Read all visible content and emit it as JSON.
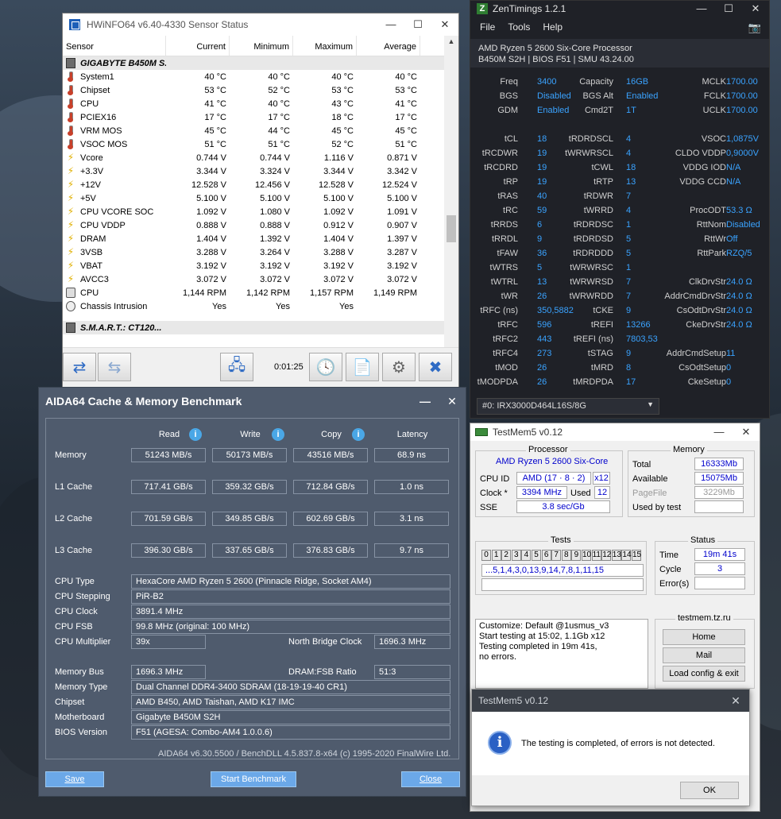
{
  "hwinfo": {
    "title": "HWiNFO64 v6.40-4330 Sensor Status",
    "columns": [
      "Sensor",
      "Current",
      "Minimum",
      "Maximum",
      "Average"
    ],
    "group1": "GIGABYTE B450M S...",
    "rows": [
      {
        "icon": "temp",
        "name": "System1",
        "cur": "40 °C",
        "min": "40 °C",
        "max": "40 °C",
        "avg": "40 °C"
      },
      {
        "icon": "temp",
        "name": "Chipset",
        "cur": "53 °C",
        "min": "52 °C",
        "max": "53 °C",
        "avg": "53 °C"
      },
      {
        "icon": "temp",
        "name": "CPU",
        "cur": "41 °C",
        "min": "40 °C",
        "max": "43 °C",
        "avg": "41 °C"
      },
      {
        "icon": "temp",
        "name": "PCIEX16",
        "cur": "17 °C",
        "min": "17 °C",
        "max": "18 °C",
        "avg": "17 °C"
      },
      {
        "icon": "temp",
        "name": "VRM MOS",
        "cur": "45 °C",
        "min": "44 °C",
        "max": "45 °C",
        "avg": "45 °C"
      },
      {
        "icon": "temp",
        "name": "VSOC MOS",
        "cur": "51 °C",
        "min": "51 °C",
        "max": "52 °C",
        "avg": "51 °C"
      },
      {
        "icon": "volt",
        "name": "Vcore",
        "cur": "0.744 V",
        "min": "0.744 V",
        "max": "1.116 V",
        "avg": "0.871 V"
      },
      {
        "icon": "volt",
        "name": "+3.3V",
        "cur": "3.344 V",
        "min": "3.324 V",
        "max": "3.344 V",
        "avg": "3.342 V"
      },
      {
        "icon": "volt",
        "name": "+12V",
        "cur": "12.528 V",
        "min": "12.456 V",
        "max": "12.528 V",
        "avg": "12.524 V"
      },
      {
        "icon": "volt",
        "name": "+5V",
        "cur": "5.100 V",
        "min": "5.100 V",
        "max": "5.100 V",
        "avg": "5.100 V"
      },
      {
        "icon": "volt",
        "name": "CPU VCORE SOC",
        "cur": "1.092 V",
        "min": "1.080 V",
        "max": "1.092 V",
        "avg": "1.091 V"
      },
      {
        "icon": "volt",
        "name": "CPU VDDP",
        "cur": "0.888 V",
        "min": "0.888 V",
        "max": "0.912 V",
        "avg": "0.907 V"
      },
      {
        "icon": "volt",
        "name": "DRAM",
        "cur": "1.404 V",
        "min": "1.392 V",
        "max": "1.404 V",
        "avg": "1.397 V"
      },
      {
        "icon": "volt",
        "name": "3VSB",
        "cur": "3.288 V",
        "min": "3.264 V",
        "max": "3.288 V",
        "avg": "3.287 V"
      },
      {
        "icon": "volt",
        "name": "VBAT",
        "cur": "3.192 V",
        "min": "3.192 V",
        "max": "3.192 V",
        "avg": "3.192 V"
      },
      {
        "icon": "volt",
        "name": "AVCC3",
        "cur": "3.072 V",
        "min": "3.072 V",
        "max": "3.072 V",
        "avg": "3.072 V"
      },
      {
        "icon": "fan",
        "name": "CPU",
        "cur": "1,144 RPM",
        "min": "1,142 RPM",
        "max": "1,157 RPM",
        "avg": "1,149 RPM"
      },
      {
        "icon": "intr",
        "name": "Chassis Intrusion",
        "cur": "Yes",
        "min": "Yes",
        "max": "Yes",
        "avg": ""
      }
    ],
    "group2": "S.M.A.R.T.: CT120...",
    "timer": "0:01:25"
  },
  "zen": {
    "title": "ZenTimings 1.2.1",
    "menu": [
      "File",
      "Tools",
      "Help"
    ],
    "cpu": "AMD Ryzen 5 2600 Six-Core Processor",
    "board": "B450M S2H | BIOS F51 | SMU 43.24.00",
    "top": [
      [
        "Freq",
        "3400",
        "Capacity",
        "16GB",
        "MCLK",
        "1700.00"
      ],
      [
        "BGS",
        "Disabled",
        "BGS Alt",
        "Enabled",
        "FCLK",
        "1700.00"
      ],
      [
        "GDM",
        "Enabled",
        "Cmd2T",
        "1T",
        "UCLK",
        "1700.00"
      ]
    ],
    "timings": [
      [
        "tCL",
        "18",
        "tRDRDSCL",
        "4",
        "VSOC",
        "1,0875V"
      ],
      [
        "tRCDWR",
        "19",
        "tWRWRSCL",
        "4",
        "CLDO VDDP",
        "0,9000V"
      ],
      [
        "tRCDRD",
        "19",
        "tCWL",
        "18",
        "VDDG IOD",
        "N/A"
      ],
      [
        "tRP",
        "19",
        "tRTP",
        "13",
        "VDDG CCD",
        "N/A"
      ],
      [
        "tRAS",
        "40",
        "tRDWR",
        "7",
        "",
        ""
      ],
      [
        "tRC",
        "59",
        "tWRRD",
        "4",
        "ProcODT",
        "53.3 Ω"
      ],
      [
        "tRRDS",
        "6",
        "tRDRDSC",
        "1",
        "RttNom",
        "Disabled"
      ],
      [
        "tRRDL",
        "9",
        "tRDRDSD",
        "5",
        "RttWr",
        "Off"
      ],
      [
        "tFAW",
        "36",
        "tRDRDDD",
        "5",
        "RttPark",
        "RZQ/5"
      ],
      [
        "tWTRS",
        "5",
        "tWRWRSC",
        "1",
        "",
        ""
      ],
      [
        "tWTRL",
        "13",
        "tWRWRSD",
        "7",
        "ClkDrvStr",
        "24.0 Ω"
      ],
      [
        "tWR",
        "26",
        "tWRWRDD",
        "7",
        "AddrCmdDrvStr",
        "24.0 Ω"
      ],
      [
        "tRFC (ns)",
        "350,5882",
        "tCKE",
        "9",
        "CsOdtDrvStr",
        "24.0 Ω"
      ],
      [
        "tRFC",
        "596",
        "tREFI",
        "13266",
        "CkeDrvStr",
        "24.0 Ω"
      ],
      [
        "tRFC2",
        "443",
        "tREFI (ns)",
        "7803,53",
        "",
        ""
      ],
      [
        "tRFC4",
        "273",
        "tSTAG",
        "9",
        "AddrCmdSetup",
        "11"
      ],
      [
        "tMOD",
        "26",
        "tMRD",
        "8",
        "CsOdtSetup",
        "0"
      ],
      [
        "tMODPDA",
        "26",
        "tMRDPDA",
        "17",
        "CkeSetup",
        "0"
      ]
    ],
    "dimm": "#0: IRX3000D464L16S/8G"
  },
  "aida": {
    "title": "AIDA64 Cache & Memory Benchmark",
    "headers": [
      "Read",
      "Write",
      "Copy",
      "Latency"
    ],
    "bench": [
      [
        "Memory",
        "51243 MB/s",
        "50173 MB/s",
        "43516 MB/s",
        "68.9 ns"
      ],
      [
        "L1 Cache",
        "717.41 GB/s",
        "359.32 GB/s",
        "712.84 GB/s",
        "1.0 ns"
      ],
      [
        "L2 Cache",
        "701.59 GB/s",
        "349.85 GB/s",
        "602.69 GB/s",
        "3.1 ns"
      ],
      [
        "L3 Cache",
        "396.30 GB/s",
        "337.65 GB/s",
        "376.83 GB/s",
        "9.7 ns"
      ]
    ],
    "cpu_type_label": "CPU Type",
    "cpu_type": "HexaCore AMD Ryzen 5 2600  (Pinnacle Ridge, Socket AM4)",
    "cpu_stepping_label": "CPU Stepping",
    "cpu_stepping": "PiR-B2",
    "cpu_clock_label": "CPU Clock",
    "cpu_clock": "3891.4 MHz",
    "cpu_fsb_label": "CPU FSB",
    "cpu_fsb": "99.8 MHz  (original: 100 MHz)",
    "cpu_mult_label": "CPU Multiplier",
    "cpu_mult": "39x",
    "nb_clock_label": "North Bridge Clock",
    "nb_clock": "1696.3 MHz",
    "mem_bus_label": "Memory Bus",
    "mem_bus": "1696.3 MHz",
    "dram_ratio_label": "DRAM:FSB Ratio",
    "dram_ratio": "51:3",
    "mem_type_label": "Memory Type",
    "mem_type": "Dual Channel DDR4-3400 SDRAM  (18-19-19-40 CR1)",
    "chipset_label": "Chipset",
    "chipset": "AMD B450, AMD Taishan, AMD K17 IMC",
    "mobo_label": "Motherboard",
    "mobo": "Gigabyte B450M S2H",
    "bios_label": "BIOS Version",
    "bios": "F51  (AGESA: Combo-AM4 1.0.0.6)",
    "footer": "AIDA64 v6.30.5500 / BenchDLL 4.5.837.8-x64  (c) 1995-2020 FinalWire Ltd.",
    "save": "Save",
    "start": "Start Benchmark",
    "close": "Close"
  },
  "tm": {
    "title": "TestMem5 v0.12",
    "proc_title": "Processor",
    "proc_name": "AMD Ryzen 5 2600 Six-Core",
    "cpuid_label": "CPU ID",
    "cpuid": "AMD  (17 · 8 · 2)",
    "threads": "x12",
    "clock_label": "Clock *",
    "clock": "3394 MHz",
    "used_label": "Used",
    "used": "12",
    "sse_label": "SSE",
    "sse": "3.8 sec/Gb",
    "mem_title": "Memory",
    "total_label": "Total",
    "total": "16333Mb",
    "avail_label": "Available",
    "avail": "15075Mb",
    "pagefile_label": "PageFile",
    "pagefile": "3229Mb",
    "usedby_label": "Used by test",
    "usedby": "",
    "tests_title": "Tests",
    "test_nums": [
      "0",
      "1",
      "2",
      "3",
      "4",
      "5",
      "6",
      "7",
      "8",
      "9",
      "10",
      "11",
      "12",
      "13",
      "14",
      "15"
    ],
    "seq": "...5,1,4,3,0,13,9,14,7,8,1,11,15",
    "status_title": "Status",
    "time_label": "Time",
    "time": "19m 41s",
    "cycle_label": "Cycle",
    "cycle": "3",
    "errors_label": "Error(s)",
    "errors": "",
    "log": [
      "Customize: Default @1usmus_v3",
      "Start testing at 15:02, 1.1Gb x12",
      "Testing completed in 19m 41s,",
      "no errors."
    ],
    "site": "testmem.tz.ru",
    "home": "Home",
    "mail": "Mail",
    "load": "Load config & exit"
  },
  "msg": {
    "title": "TestMem5 v0.12",
    "text": "The testing is completed, of errors is not detected.",
    "ok": "OK"
  }
}
